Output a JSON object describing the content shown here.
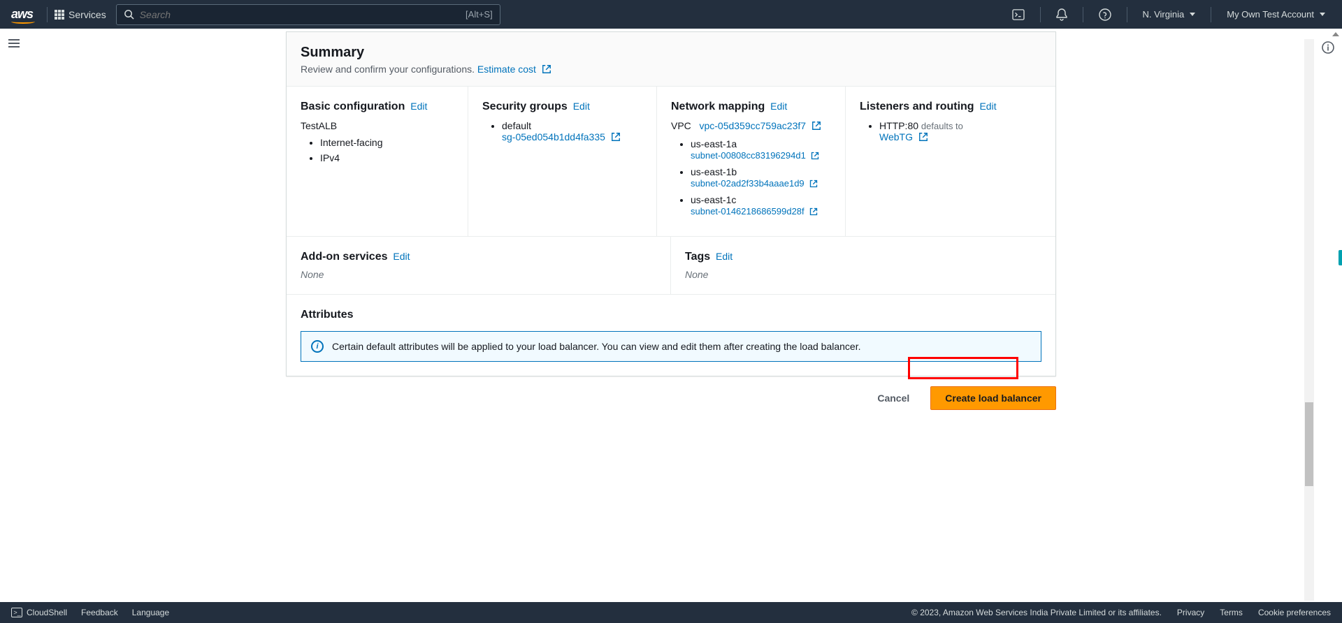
{
  "nav": {
    "services": "Services",
    "search_placeholder": "Search",
    "search_shortcut": "[Alt+S]",
    "region": "N. Virginia",
    "account": "My Own Test Account"
  },
  "summary": {
    "title": "Summary",
    "subtitle": "Review and confirm your configurations.",
    "estimate": "Estimate cost"
  },
  "basic": {
    "heading": "Basic configuration",
    "edit": "Edit",
    "name": "TestALB",
    "scheme": "Internet-facing",
    "ip": "IPv4"
  },
  "security": {
    "heading": "Security groups",
    "edit": "Edit",
    "group_name": "default",
    "group_id": "sg-05ed054b1dd4fa335"
  },
  "network": {
    "heading": "Network mapping",
    "edit": "Edit",
    "vpc_label": "VPC",
    "vpc_id": "vpc-05d359cc759ac23f7",
    "azs": [
      {
        "zone": "us-east-1a",
        "subnet": "subnet-00808cc83196294d1"
      },
      {
        "zone": "us-east-1b",
        "subnet": "subnet-02ad2f33b4aaae1d9"
      },
      {
        "zone": "us-east-1c",
        "subnet": "subnet-0146218686599d28f"
      }
    ]
  },
  "listeners": {
    "heading": "Listeners and routing",
    "edit": "Edit",
    "protocol": "HTTP:80",
    "defaults_to": "defaults to",
    "target": "WebTG"
  },
  "addon": {
    "heading": "Add-on services",
    "edit": "Edit",
    "value": "None"
  },
  "tags": {
    "heading": "Tags",
    "edit": "Edit",
    "value": "None"
  },
  "attributes": {
    "heading": "Attributes",
    "info": "Certain default attributes will be applied to your load balancer. You can view and edit them after creating the load balancer."
  },
  "actions": {
    "cancel": "Cancel",
    "create": "Create load balancer"
  },
  "footer": {
    "cloudshell": "CloudShell",
    "feedback": "Feedback",
    "language": "Language",
    "copyright": "© 2023, Amazon Web Services India Private Limited or its affiliates.",
    "privacy": "Privacy",
    "terms": "Terms",
    "cookies": "Cookie preferences"
  }
}
